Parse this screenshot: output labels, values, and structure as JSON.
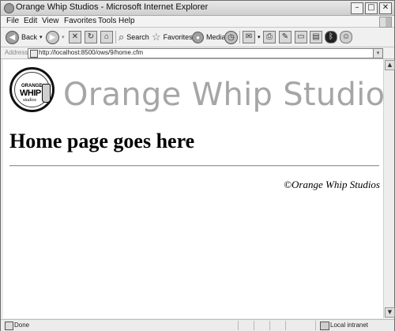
{
  "window": {
    "title": "Orange Whip Studios - Microsoft Internet Explorer",
    "buttons": {
      "minimize": "–",
      "maximize": "□",
      "close": "✕"
    }
  },
  "menu": [
    "File",
    "Edit",
    "View",
    "Favorites",
    "Tools",
    "Help"
  ],
  "toolbar": {
    "back": "Back",
    "search": "Search",
    "favorites": "Favorites",
    "media": "Media"
  },
  "address": {
    "label": "Address",
    "url": "http://localhost:8500/ows/9/home.cfm"
  },
  "page": {
    "logo": {
      "line1": "ORANGE",
      "line2": "WHIP",
      "line3": "studios"
    },
    "site_title": "Orange Whip Studios",
    "heading": "Home page goes here",
    "footer": "©Orange Whip Studios"
  },
  "status": {
    "text": "Done",
    "zone": "Local intranet"
  }
}
